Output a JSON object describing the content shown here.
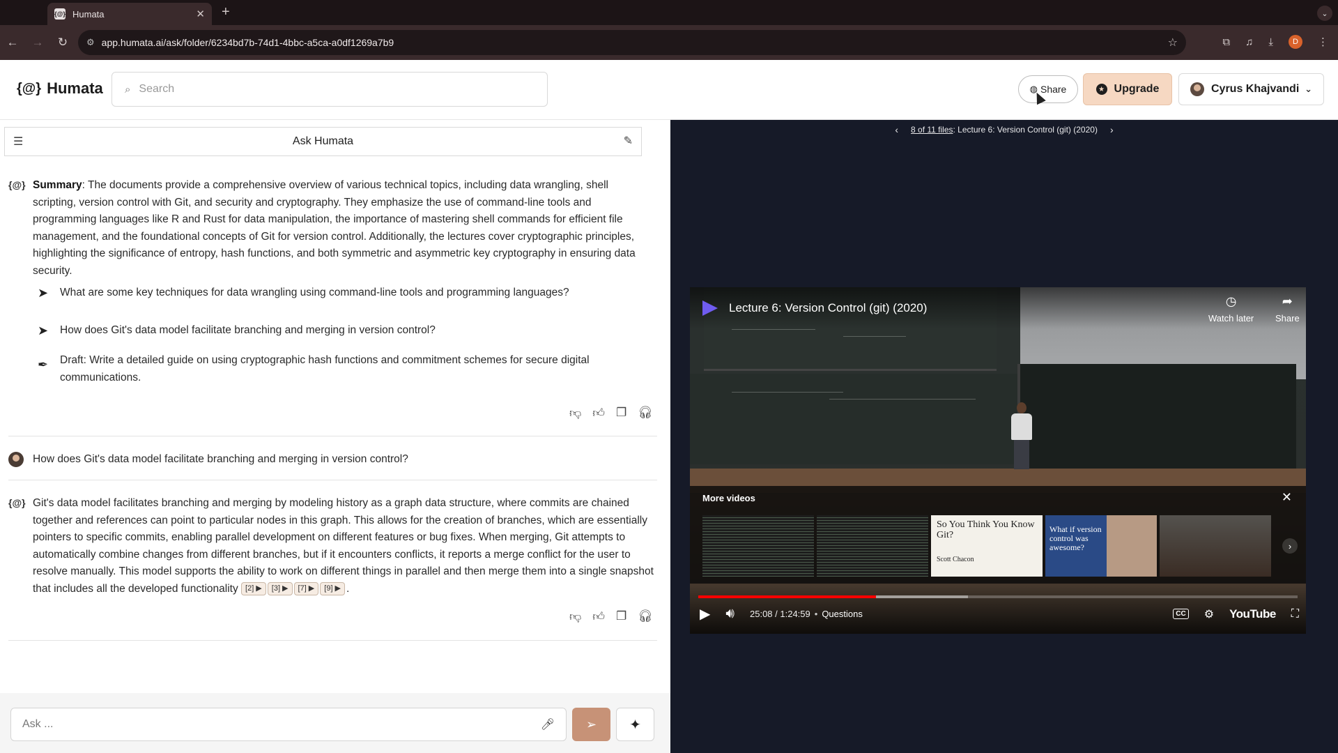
{
  "browser": {
    "tab_title": "Humata",
    "url": "app.humata.ai/ask/folder/6234bd7b-74d1-4bbc-a5ca-a0df1269a7b9",
    "profile_initial": "D"
  },
  "header": {
    "logo_text": "Humata",
    "search_placeholder": "Search",
    "share_label": "Share",
    "upgrade_label": "Upgrade",
    "user_name": "Cyrus Khajvandi"
  },
  "chat": {
    "title": "Ask Humata",
    "summary_label": "Summary",
    "summary_text": ": The documents provide a comprehensive overview of various technical topics, including data wrangling, shell scripting, version control with Git, and security and cryptography. They emphasize the use of command-line tools and programming languages like R and Rust for data manipulation, the importance of mastering shell commands for efficient file management, and the foundational concepts of Git for version control. Additionally, the lectures cover cryptographic principles, highlighting the significance of entropy, hash functions, and both symmetric and asymmetric key cryptography in ensuring data security.",
    "suggestions": [
      "What are some key techniques for data wrangling using command-line tools and programming languages?",
      "How does Git's data model facilitate branching and merging in version control?"
    ],
    "draft": "Draft: Write a detailed guide on using cryptographic hash functions and commitment schemes for secure digital communications.",
    "user_question": "How does Git's data model facilitate branching and merging in version control?",
    "answer": "Git's data model facilitates branching and merging by modeling history as a graph data structure, where commits are chained together and references can point to particular nodes in this graph. This allows for the creation of branches, which are essentially pointers to specific commits, enabling parallel development on different features or bug fixes. When merging, Git attempts to automatically combine changes from different branches, but if it encounters conflicts, it reports a merge conflict for the user to resolve manually. This model supports the ability to work on different things in parallel and then merge them into a single snapshot that includes all the developed functionality",
    "references": [
      "[2] ▶",
      "[3] ▶",
      "[7] ▶",
      "[9] ▶"
    ],
    "input_placeholder": "Ask ..."
  },
  "viewer": {
    "file_position": "8 of 11 files",
    "file_name": ": Lecture 6: Version Control (git) (2020)",
    "video": {
      "title": "Lecture 6: Version Control (git) (2020)",
      "watch_later": "Watch later",
      "share": "Share",
      "more_videos": "More videos",
      "thumb_git_text": "So You Think You Know Git?",
      "thumb_git_caption": "Scott Chacon",
      "thumb_vc_text": "What if version control was awesome?",
      "time": "25:08 / 1:24:59",
      "chapter": "Questions",
      "brand": "YouTube",
      "played_fraction": 0.296,
      "loaded_fraction": 0.45,
      "accent_color": "#ff0000"
    }
  },
  "colors": {
    "send_button": "#c79277",
    "upgrade_button": "#f6d8c2",
    "viewer_bg": "#161a28"
  }
}
